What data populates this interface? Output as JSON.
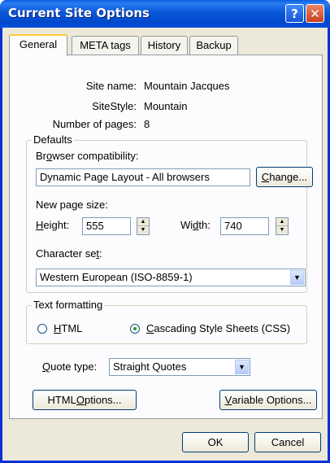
{
  "window": {
    "title": "Current Site Options",
    "help_label": "?",
    "close_label": "✕"
  },
  "tabs": [
    {
      "label": "General",
      "active": true
    },
    {
      "label": "META tags",
      "active": false
    },
    {
      "label": "History",
      "active": false
    },
    {
      "label": "Backup",
      "active": false
    }
  ],
  "site_info": {
    "site_name_label": "Site name:",
    "site_name_value": "Mountain Jacques",
    "site_style_label": "SiteStyle:",
    "site_style_value": "Mountain",
    "pages_label": "Number of pages:",
    "pages_value": "8"
  },
  "defaults": {
    "legend": "Defaults",
    "compat_label": "Browser compatibility:",
    "compat_value": "Dynamic Page Layout - All browsers",
    "change_button": "Change...",
    "page_size_label": "New page size:",
    "height_label": "Height:",
    "height_value": "555",
    "width_label": "Width:",
    "width_value": "740",
    "charset_label": "Character set:",
    "charset_value": "Western European (ISO-8859-1)"
  },
  "text_formatting": {
    "legend": "Text formatting",
    "html_label": "HTML",
    "css_label": "Cascading Style Sheets (CSS)",
    "selected": "css"
  },
  "quote": {
    "label": "Quote type:",
    "value": "Straight Quotes"
  },
  "buttons": {
    "html_options": "HTML Options...",
    "variable_options": "Variable Options...",
    "ok": "OK",
    "cancel": "Cancel"
  },
  "icons": {
    "spin_up": "▲",
    "spin_down": "▼",
    "combo_arrow": "▼"
  },
  "colors": {
    "titlebar": "#0a58d8",
    "dialog_bg": "#ece9d8",
    "panel_bg": "#fcfcfe",
    "active_tab_accent": "#ffc83c",
    "radio_dot": "#21a121"
  }
}
